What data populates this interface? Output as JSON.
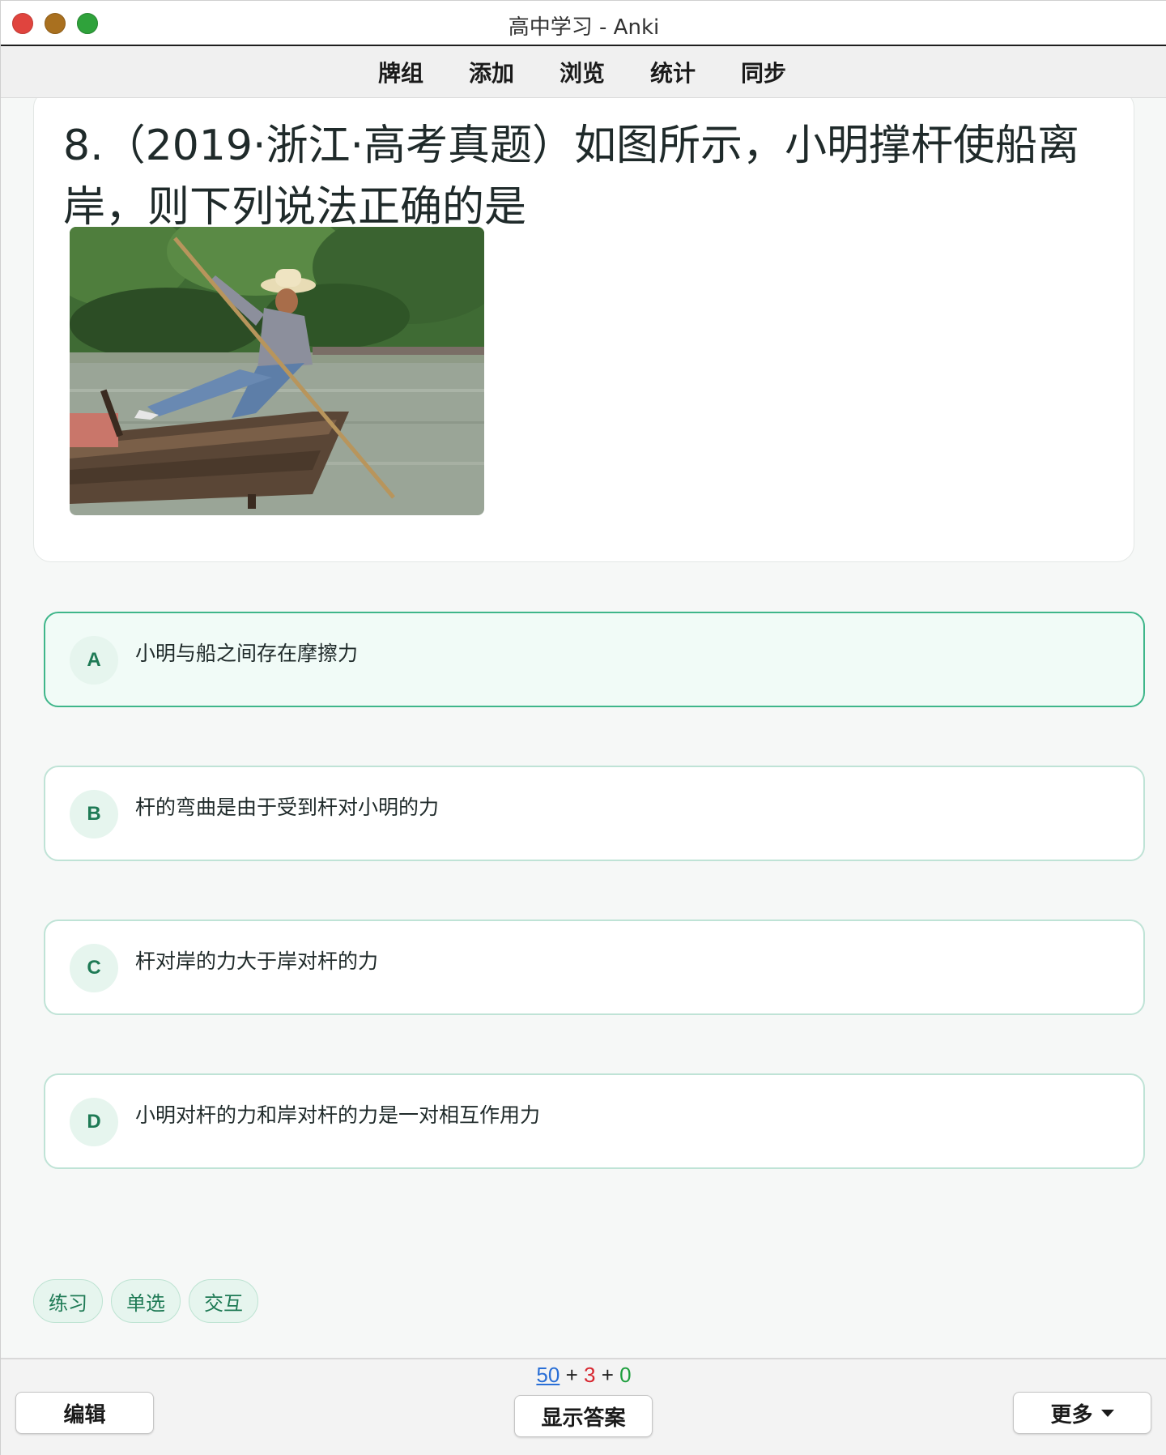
{
  "window": {
    "title": "高中学习 - Anki"
  },
  "menu": {
    "items": [
      "牌组",
      "添加",
      "浏览",
      "统计",
      "同步"
    ]
  },
  "question": {
    "text": "8.（2019·浙江·高考真题）如图所示，小明撑杆使船离岸，则下列说法正确的是"
  },
  "options": [
    {
      "letter": "A",
      "text": "小明与船之间存在摩擦力",
      "selected": true
    },
    {
      "letter": "B",
      "text": "杆的弯曲是由于受到杆对小明的力",
      "selected": false
    },
    {
      "letter": "C",
      "text": "杆对岸的力大于岸对杆的力",
      "selected": false
    },
    {
      "letter": "D",
      "text": "小明对杆的力和岸对杆的力是一对相互作用力",
      "selected": false
    }
  ],
  "tags": [
    "练习",
    "单选",
    "交互"
  ],
  "bottom": {
    "edit_label": "编辑",
    "show_answer_label": "显示答案",
    "more_label": "更多",
    "counts": {
      "new": "50",
      "learn": "3",
      "review": "0",
      "sep": "+"
    }
  },
  "colors": {
    "accent": "#3fb68a",
    "new": "#2a6fd6",
    "learn": "#d7262f",
    "review": "#1c9e3c"
  }
}
